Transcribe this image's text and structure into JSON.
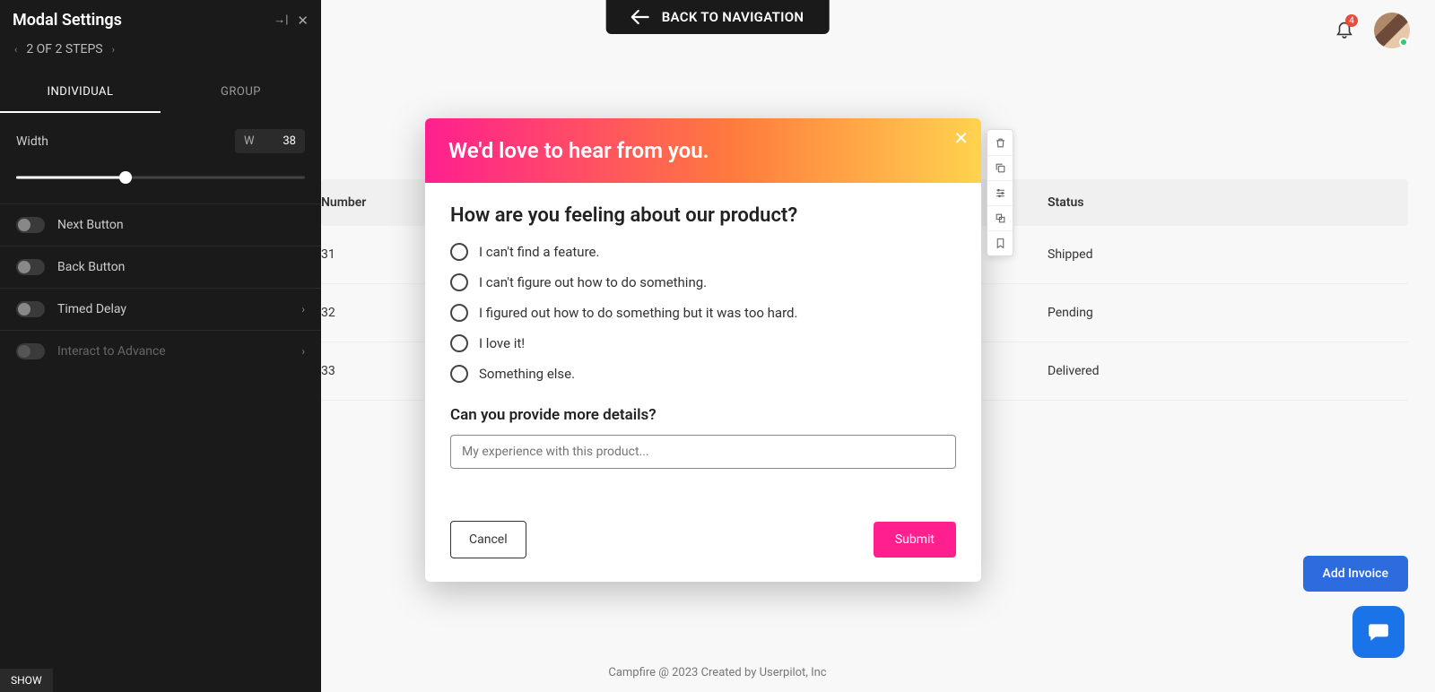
{
  "panel": {
    "title": "Modal Settings",
    "steps_text": "2 OF 2 STEPS",
    "tabs": {
      "individual": "INDIVIDUAL",
      "group": "GROUP",
      "active": "individual"
    },
    "width": {
      "label": "Width",
      "letter": "W",
      "value": "38",
      "percent": 38
    },
    "options": {
      "next_button": "Next Button",
      "back_button": "Back Button",
      "timed_delay": "Timed Delay",
      "interact_advance": "Interact to Advance"
    }
  },
  "back_nav": "BACK TO NAVIGATION",
  "notifications": {
    "count": "4"
  },
  "table": {
    "headers": {
      "number": "Number",
      "status": "Status"
    },
    "rows": [
      {
        "num": "31",
        "status": "Shipped"
      },
      {
        "num": "32",
        "status": "Pending"
      },
      {
        "num": "33",
        "status": "Delivered"
      }
    ]
  },
  "add_invoice_btn": "Add Invoice",
  "footer": "Campfire @ 2023 Created by Userpilot, Inc",
  "feedback": {
    "banner": "We'd love to hear from you.",
    "q1": "How are you feeling about our product?",
    "options": [
      "I can't find a feature.",
      "I can't figure out how to do something.",
      "I figured out how to do something but it was too hard.",
      "I love it!",
      "Something else."
    ],
    "q2": "Can you provide more details?",
    "placeholder": "My experience with this product...",
    "cancel": "Cancel",
    "submit": "Submit"
  },
  "show_btn": "SHOW"
}
